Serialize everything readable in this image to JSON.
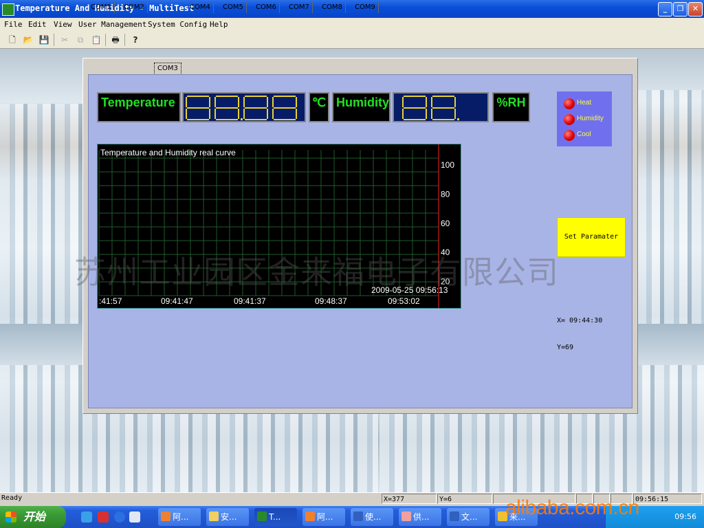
{
  "window": {
    "title": "Temperature And Humidity - MultiTest"
  },
  "menu": [
    "File",
    "Edit",
    "View",
    "User Management",
    "System Config",
    "Help"
  ],
  "toolbar_icons": [
    "new-file-icon",
    "open-folder-icon",
    "save-icon",
    "cut-icon",
    "copy-icon",
    "paste-icon",
    "print-icon",
    "help-icon"
  ],
  "tabs": [
    "COM1",
    "COM2",
    "COM3",
    "COM4",
    "COM5",
    "COM6",
    "COM7",
    "COM8",
    "COM9"
  ],
  "active_tab": "COM3",
  "display": {
    "temp_label": "Temperature",
    "temp_unit": "℃",
    "humidity_label": "Humidity",
    "humidity_unit": "%RH"
  },
  "indicators": [
    "Heat",
    "Humidity",
    "Cool"
  ],
  "chart": {
    "title": "Temperature and Humidity real curve",
    "y_ticks": [
      "100",
      "80",
      "60",
      "40",
      "20"
    ],
    "x_ticks": [
      ":41:57",
      "09:41:47",
      "09:41:37",
      "09:48:37",
      "09:53:02"
    ],
    "timestamp": "2009-05-25  09:56:13"
  },
  "chart_data": {
    "type": "line",
    "title": "Temperature and Humidity real curve",
    "xlabel": "",
    "ylabel": "",
    "ylim": [
      0,
      100
    ],
    "categories": [
      ":41:57",
      "09:41:47",
      "09:41:37",
      "09:48:37",
      "09:53:02"
    ],
    "series": [],
    "grid": true
  },
  "set_button": "Set Paramater",
  "cursor": {
    "x_text": "X= 09:44:30",
    "y_text": "Y=69"
  },
  "watermark": "苏州工业园区金来福电子有限公司",
  "statusbar": {
    "ready": "Ready",
    "x": "X=377",
    "y": "Y=6",
    "time": "09:56:15"
  },
  "taskbar": {
    "start": "开始",
    "tasks": [
      "阿...",
      "安...",
      "T...",
      "阿...",
      "使...",
      "供...",
      "文...",
      "来..."
    ],
    "clock": "09:56"
  },
  "overlay_watermark": "alibaba.com.cn",
  "colors": {
    "lcd_green": "#22e022",
    "digit_yellow": "#e8d230",
    "panel_blue": "#a9b4e6",
    "led_red": "#e00000",
    "param_yellow": "#ffff00"
  }
}
